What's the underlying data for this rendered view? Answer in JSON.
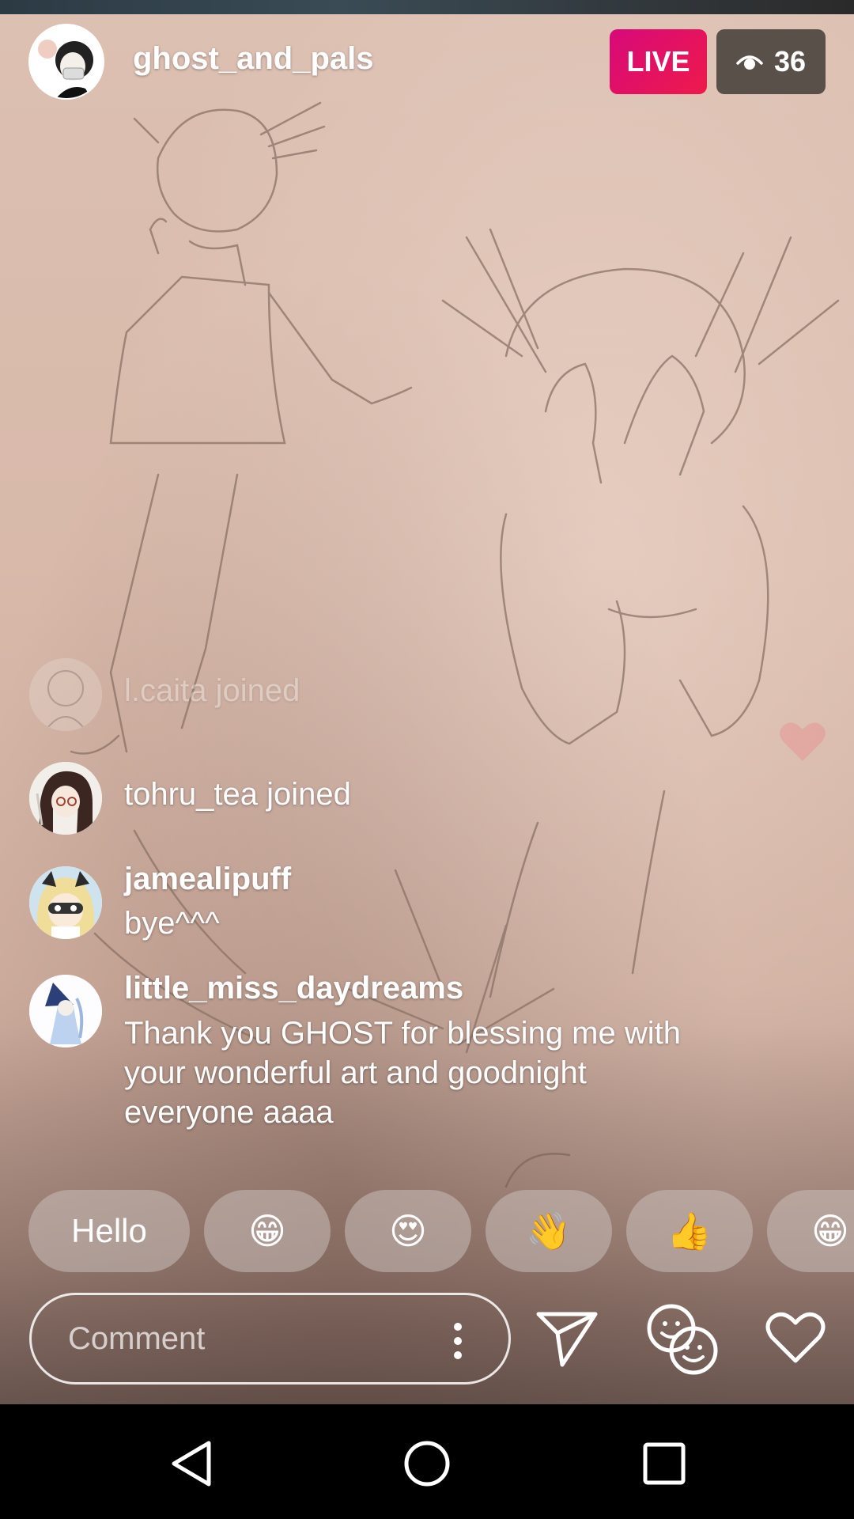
{
  "header": {
    "username": "ghost_and_pals",
    "live_label": "LIVE",
    "viewer_count": "36",
    "eye_icon": "eye-icon"
  },
  "comments": [
    {
      "user": "l.caita",
      "text": "l.caita joined",
      "faded": true
    },
    {
      "user": "tohru_tea",
      "text": "tohru_tea joined"
    },
    {
      "user": "jamealipuff",
      "text": "bye^^^"
    },
    {
      "user": "little_miss_daydreams",
      "text": "Thank you GHOST for blessing me with your wonderful art and goodnight everyone aaaa"
    }
  ],
  "quick_reactions": [
    "Hello",
    "😁",
    "😍",
    "👋",
    "👍",
    "😁"
  ],
  "comment_bar": {
    "placeholder": "Comment",
    "icons": [
      "more-vertical-icon",
      "send-icon",
      "face-filters-icon",
      "heart-icon"
    ]
  },
  "navbar": {
    "icons": [
      "back-icon",
      "home-icon",
      "recents-icon"
    ]
  },
  "colors": {
    "live_gradient_start": "#d7097a",
    "live_gradient_end": "#ee1a4b"
  }
}
